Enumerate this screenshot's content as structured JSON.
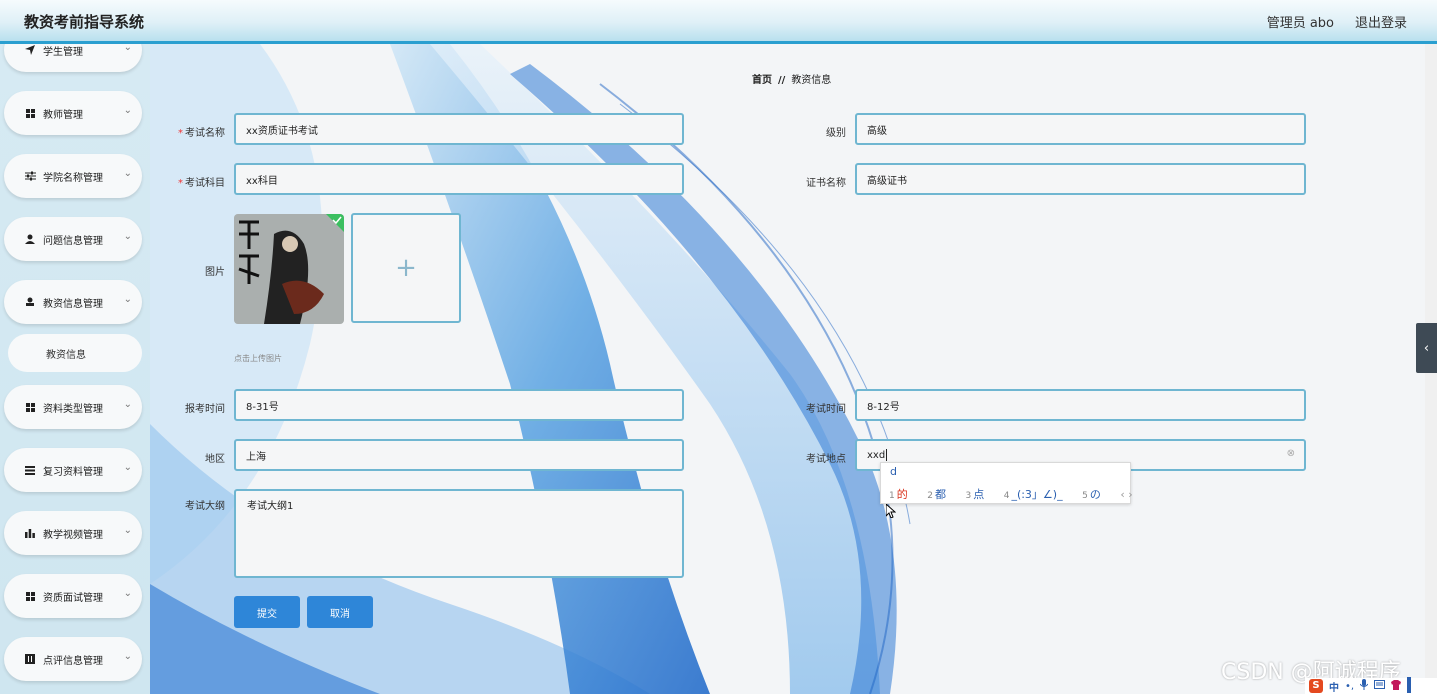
{
  "header": {
    "app_title": "教资考前指导系统",
    "admin_label": "管理员 abo",
    "logout_label": "退出登录"
  },
  "sidebar": {
    "items": [
      {
        "label": "学生管理",
        "icon": "send-icon"
      },
      {
        "label": "教师管理",
        "icon": "grid-icon"
      },
      {
        "label": "学院名称管理",
        "icon": "sliders-icon"
      },
      {
        "label": "问题信息管理",
        "icon": "user-icon"
      },
      {
        "label": "教资信息管理",
        "icon": "stamp-icon"
      },
      {
        "label": "资料类型管理",
        "icon": "grid-icon"
      },
      {
        "label": "复习资料管理",
        "icon": "list-icon"
      },
      {
        "label": "教学视频管理",
        "icon": "bar-chart-icon"
      },
      {
        "label": "资质面试管理",
        "icon": "grid-icon"
      },
      {
        "label": "点评信息管理",
        "icon": "book-icon"
      }
    ],
    "subitem": "教资信息"
  },
  "breadcrumb": {
    "home": "首页",
    "separator": "//",
    "current": "教资信息"
  },
  "form": {
    "exam_name_label": "考试名称",
    "exam_name_value": "xx资质证书考试",
    "level_label": "级别",
    "level_value": "高级",
    "subject_label": "考试科目",
    "subject_value": "xx科目",
    "cert_label": "证书名称",
    "cert_value": "高级证书",
    "image_label": "图片",
    "upload_hint": "点击上传图片",
    "reg_time_label": "报考时间",
    "reg_time_value": "8-31号",
    "exam_time_label": "考试时间",
    "exam_time_value": "8-12号",
    "region_label": "地区",
    "region_value": "上海",
    "location_label": "考试地点",
    "location_value": "xxd",
    "outline_label": "考试大纲",
    "outline_value": "考试大纲1",
    "submit_label": "提交",
    "cancel_label": "取消",
    "required_mark": "*"
  },
  "ime": {
    "input": "d",
    "candidates": [
      {
        "num": "1",
        "text": "的"
      },
      {
        "num": "2",
        "text": "都"
      },
      {
        "num": "3",
        "text": "点"
      },
      {
        "num": "4",
        "text": "_(:3」∠)_"
      },
      {
        "num": "5",
        "text": "の"
      }
    ],
    "nav": "‹ ›"
  },
  "watermark": "CSDN @阿诚程序",
  "tray": {
    "ime_logo": "S",
    "mode": "中"
  },
  "colors": {
    "accent": "#2e86d8",
    "input_border": "#6fb6d1",
    "header_bar": "#2a9fd0"
  }
}
